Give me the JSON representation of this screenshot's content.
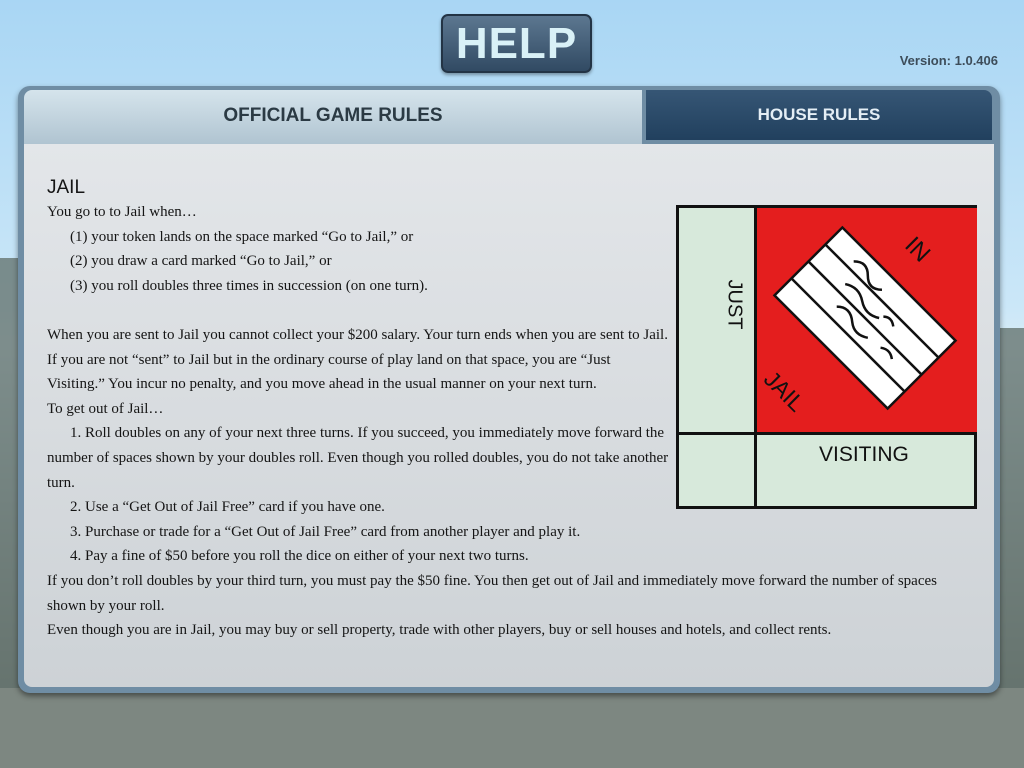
{
  "header": {
    "title": "HELP",
    "version": "Version: 1.0.406"
  },
  "tabs": [
    {
      "label": "OFFICIAL GAME RULES",
      "active": true
    },
    {
      "label": "HOUSE RULES",
      "active": false
    }
  ],
  "rules": {
    "heading": "JAIL",
    "lines": [
      "You go to to Jail when…",
      "(1) your token lands on the space marked “Go to Jail,” or",
      "(2) you draw a card marked “Go to Jail,” or",
      "(3) you roll doubles three times in succession (on one turn).",
      "When you are sent to Jail you cannot collect your $200 salary. Your turn ends when you are sent to Jail.",
      "If you are not “sent” to Jail but in the ordinary course of play land on that space, you are “Just Visiting.” You incur no penalty, and you move ahead in the usual manner on your next turn.",
      "To get out of Jail…",
      "1. Roll doubles on any of your next three turns. If you succeed, you immediately move forward the number of spaces shown by your doubles roll. Even though you rolled doubles, you do not take another turn.",
      "2. Use a “Get Out of Jail Free” card if you have one.",
      "3. Purchase or trade for a “Get Out of Jail Free” card from another player and play it.",
      "4. Pay a fine of $50 before you roll the dice on either of your next two turns.",
      "If you don’t roll doubles by your third turn, you must pay the $50 fine. You then get out of Jail and immediately move forward the number of spaces shown by your roll.",
      "Even though you are in Jail, you may buy or sell property, trade with other players, buy or sell houses and hotels, and collect rents."
    ]
  },
  "jail_card": {
    "just": "JUST",
    "visiting": "VISITING",
    "in": "IN",
    "jail": "JAIL",
    "colors": {
      "red": "#e41e1e",
      "green": "#d7e9db"
    }
  }
}
